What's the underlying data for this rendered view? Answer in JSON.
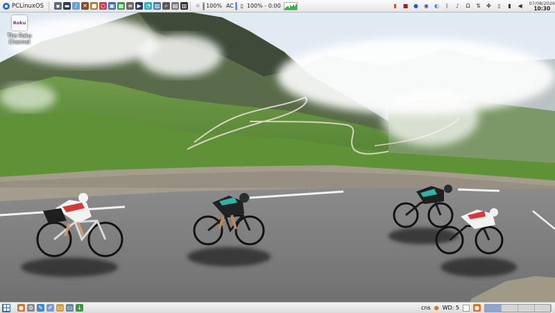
{
  "top_panel": {
    "menu_label": "PCLinuxOS",
    "launchers": [
      {
        "icon": "floppy-disk-icon",
        "color": "#5b6b7a",
        "glyph": "▪"
      },
      {
        "icon": "terminal-icon",
        "color": "#2b3a5a",
        "glyph": "▬"
      },
      {
        "icon": "syringe-icon",
        "color": "#6aa0d8",
        "glyph": "/"
      },
      {
        "icon": "tools-icon",
        "color": "#8a4b2a",
        "glyph": "✕"
      },
      {
        "icon": "package-icon",
        "color": "#b07a3a",
        "glyph": "■"
      },
      {
        "icon": "ring-icon",
        "color": "#c43c5a",
        "glyph": "○"
      },
      {
        "icon": "screenshot-icon",
        "color": "#3a6fc0",
        "glyph": "▣"
      },
      {
        "icon": "spreadsheet-icon",
        "color": "#3a9a4a",
        "glyph": "▦"
      },
      {
        "icon": "document-icon",
        "color": "#6a6a6a",
        "glyph": "≡"
      },
      {
        "icon": "media-player-icon",
        "color": "#2a3a6a",
        "glyph": "▶"
      },
      {
        "icon": "chat-icon",
        "color": "#2ab0c0",
        "glyph": "◔"
      },
      {
        "icon": "image-viewer-icon",
        "color": "#4a7ab0",
        "glyph": "▨"
      },
      {
        "icon": "search-icon",
        "color": "#5a5a5a",
        "glyph": "⌕"
      },
      {
        "icon": "calculator-icon",
        "color": "#7a7a7a",
        "glyph": "▤"
      },
      {
        "icon": "film-icon",
        "color": "#303030",
        "glyph": "▥"
      }
    ],
    "brightness_label": "100%",
    "brightness_level": 0.9,
    "ac_label": "AC",
    "battery_label": "100% - 0:00",
    "battery_level": 1.0,
    "graph_levels": [
      0.2,
      0.35,
      0.5,
      0.3,
      0.6,
      0.45,
      0.7,
      0.5,
      0.8
    ],
    "tray_icons": [
      {
        "icon": "lock-icon",
        "color": "#e05030",
        "glyph": "▮"
      },
      {
        "icon": "notes-icon",
        "color": "#a02020",
        "glyph": "■"
      },
      {
        "icon": "chromium-icon",
        "color": "#2a5ad8",
        "glyph": "●"
      },
      {
        "icon": "power-icon",
        "color": "#4a4a9a",
        "glyph": "◉"
      },
      {
        "icon": "earth-icon",
        "color": "#3a7ad0",
        "glyph": "◐"
      },
      {
        "icon": "bluetooth-icon",
        "color": "#2a2a8a",
        "glyph": "ᛒ"
      },
      {
        "icon": "microphone-icon",
        "color": "#505050",
        "glyph": "♪"
      },
      {
        "icon": "omega-icon",
        "color": "#303030",
        "glyph": "Ω"
      },
      {
        "icon": "network-icon",
        "color": "#404040",
        "glyph": "⇅"
      },
      {
        "icon": "accessibility-icon",
        "color": "#303030",
        "glyph": "✥"
      },
      {
        "icon": "clipboard-icon",
        "color": "#404040",
        "glyph": "▯"
      },
      {
        "icon": "battery-icon",
        "color": "#303030",
        "glyph": "▮"
      },
      {
        "icon": "volume-icon",
        "color": "#303030",
        "glyph": "◀"
      }
    ],
    "clock_date": "07/08/2026",
    "clock_time": "10:30"
  },
  "desktop": {
    "icons": [
      {
        "label_line1": "The Roku",
        "label_line2": "Channel",
        "logo_text": "Roku"
      }
    ]
  },
  "bottom_panel": {
    "launchers": [
      {
        "icon": "firefox-icon",
        "color": "#e0702a",
        "glyph": "●"
      },
      {
        "icon": "settings-icon",
        "color": "#8a8a8a",
        "glyph": "⚙"
      },
      {
        "icon": "text-editor-icon",
        "color": "#3a8ad0",
        "glyph": "✎"
      },
      {
        "icon": "paint-icon",
        "color": "#7a9ad0",
        "glyph": "✐"
      },
      {
        "icon": "file-manager-icon",
        "color": "#d0a040",
        "glyph": "▭"
      },
      {
        "icon": "display-icon",
        "color": "#6a8aa0",
        "glyph": "▭"
      },
      {
        "icon": "download-icon",
        "color": "#3a9a3a",
        "glyph": "↓"
      }
    ],
    "cns_label": "cns",
    "workspace_label": "WD: 5",
    "active_workspace": 1
  }
}
